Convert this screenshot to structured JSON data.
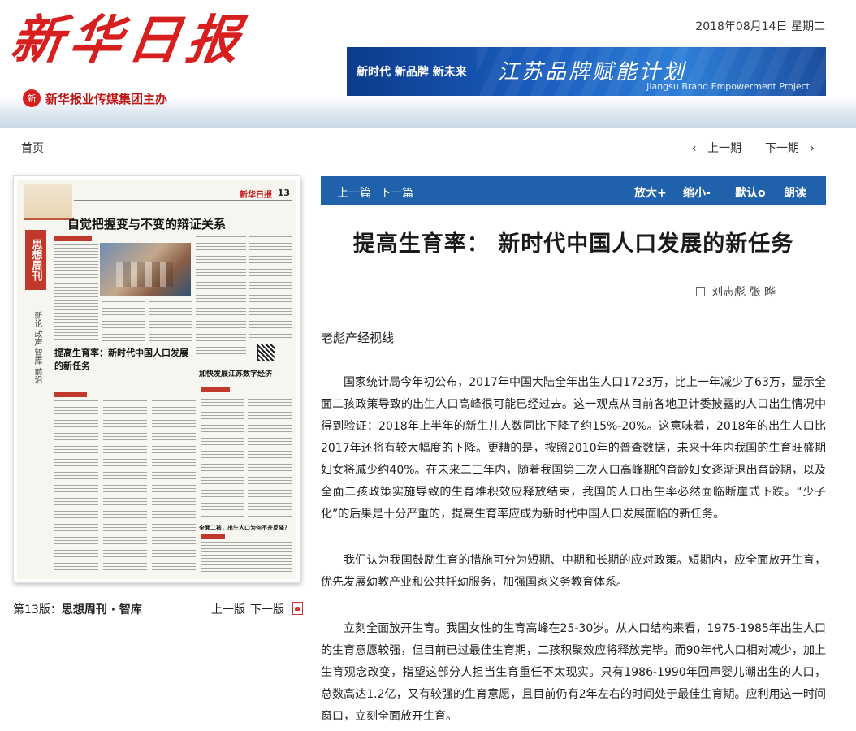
{
  "header": {
    "logo_text": "新华日报",
    "seal_glyph": "新",
    "subtitle": "新华报业传媒集团主办",
    "date": "2018年08月14日 星期二",
    "banner": {
      "tags": "新时代  新品牌  新未来",
      "title": "江苏品牌赋能计划",
      "english": "Jiangsu Brand Empowerment Project"
    }
  },
  "nav": {
    "home": "首页",
    "prev_issue": "上一期",
    "next_issue": "下一期",
    "prev_icon": "chevron-left-icon",
    "next_icon": "chevron-right-icon"
  },
  "newspaper_thumb": {
    "page_num": "13",
    "masthead": "新华日报",
    "headline": "自觉把握变与不变的辩证关系",
    "section": "思想周刊",
    "side_items": "新论 政声 智库 前沿",
    "article_title": "提高生育率：新时代中国人口发展的新任务",
    "right_title": "加快发展江苏数字经济",
    "bottom_title": "全面二孩，出生人口为何不升反降？"
  },
  "page_info": {
    "label": "第13版：",
    "name": "思想周刊 · 智库",
    "prev": "上一版",
    "next": "下一版",
    "pdf_icon": "pdf-icon"
  },
  "toolbar": {
    "prev_article": "上一篇",
    "next_article": "下一篇",
    "zoom_in": "放大+",
    "zoom_out": "缩小-",
    "default": "默认o",
    "read_aloud": "朗读"
  },
  "article": {
    "title": "提高生育率： 新时代中国人口发展的新任务",
    "author": "刘志彪 张 晔",
    "lead": "老彪产经视线",
    "paragraphs": [
      "国家统计局今年初公布，2017年中国大陆全年出生人口1723万，比上一年减少了63万，显示全面二孩政策导致的出生人口高峰很可能已经过去。这一观点从目前各地卫计委披露的人口出生情况中得到验证：2018年上半年的新生儿人数同比下降了约15%-20%。这意味着，2018年的出生人口比2017年还将有较大幅度的下降。更糟的是，按照2010年的普查数据，未来十年内我国的生育旺盛期妇女将减少约40%。在未来二三年内，随着我国第三次人口高峰期的育龄妇女逐渐退出育龄期，以及全面二孩政策实施导致的生育堆积效应释放结束，我国的人口出生率必然面临断崖式下跌。“少子化”的后果是十分严重的，提高生育率应成为新时代中国人口发展面临的新任务。",
      "我们认为我国鼓励生育的措施可分为短期、中期和长期的应对政策。短期内，应全面放开生育，优先发展幼教产业和公共托幼服务，加强国家义务教育体系。",
      "立刻全面放开生育。我国女性的生育高峰在25-30岁。从人口结构来看，1975-1985年出生人口的生育意愿较强，但目前已过最佳生育期，二孩积聚效应将释放完毕。而90年代人口相对减少，加上生育观念改变，指望这部分人担当生育重任不太现实。只有1986-1990年回声婴儿潮出生的人口，总数高达1.2亿，又有较强的生育意愿，且目前仍有2年左右的时间处于最佳生育期。应利用这一时间窗口，立刻全面放开生育。"
    ]
  }
}
